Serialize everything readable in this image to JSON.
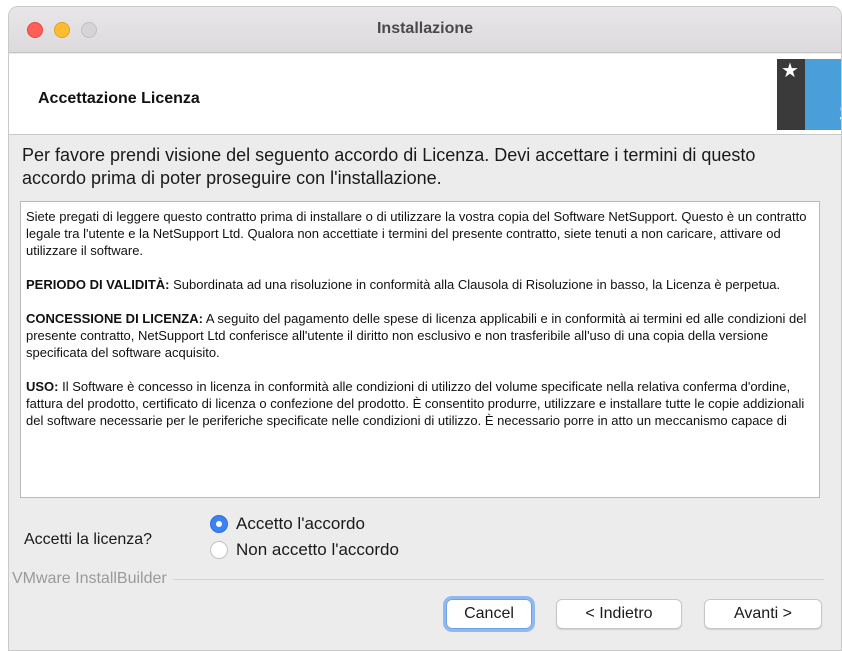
{
  "window": {
    "title": "Installazione"
  },
  "header": {
    "title": "Accettazione Licenza"
  },
  "intro": "Per favore prendi visione del seguento accordo di Licenza. Devi accettare i termini di questo accordo prima di poter proseguire con l'installazione.",
  "license": {
    "p1": "Siete pregati di leggere questo contratto prima di installare o di utilizzare la vostra copia del Software NetSupport. Questo è un contratto legale tra l'utente e la NetSupport Ltd. Qualora non accettiate i termini del presente contratto, siete tenuti a non caricare, attivare od utilizzare il software.",
    "p2_heading": "PERIODO DI VALIDITÀ:",
    "p2_body": " Subordinata ad una risoluzione in conformità alla Clausola di Risoluzione in basso, la Licenza è perpetua.",
    "p3_heading": "CONCESSIONE DI LICENZA:",
    "p3_body": " A seguito del pagamento delle spese di licenza applicabili e in conformità ai termini ed alle condizioni del presente contratto, NetSupport Ltd conferisce all'utente il diritto non esclusivo e non trasferibile all'uso di una copia della versione specificata del software acquisito.",
    "p4_heading": "USO:",
    "p4_body": " Il Software è concesso in licenza in conformità alle condizioni di utilizzo del volume specificate nella relativa conferma d'ordine, fattura del prodotto, certificato di licenza o confezione del prodotto. È consentito produrre, utilizzare e installare tutte le copie addizionali del software necessarie per le periferiche specificate nelle condizioni di utilizzo. È necessario porre in atto un meccanismo capace di"
  },
  "acceptance": {
    "question": "Accetti la licenza?",
    "options": [
      {
        "label": "Accetto l'accordo",
        "selected": true
      },
      {
        "label": "Non accetto l'accordo",
        "selected": false
      }
    ]
  },
  "footer": {
    "builder": "VMware InstallBuilder",
    "cancel_label": "Cancel",
    "back_label": "< Indietro",
    "next_label": "Avanti >"
  },
  "logo": {
    "letter": "S"
  },
  "colors": {
    "accent": "#3b82f6",
    "logo_blue": "#4a9ed9",
    "logo_dark": "#3a3a3a"
  }
}
